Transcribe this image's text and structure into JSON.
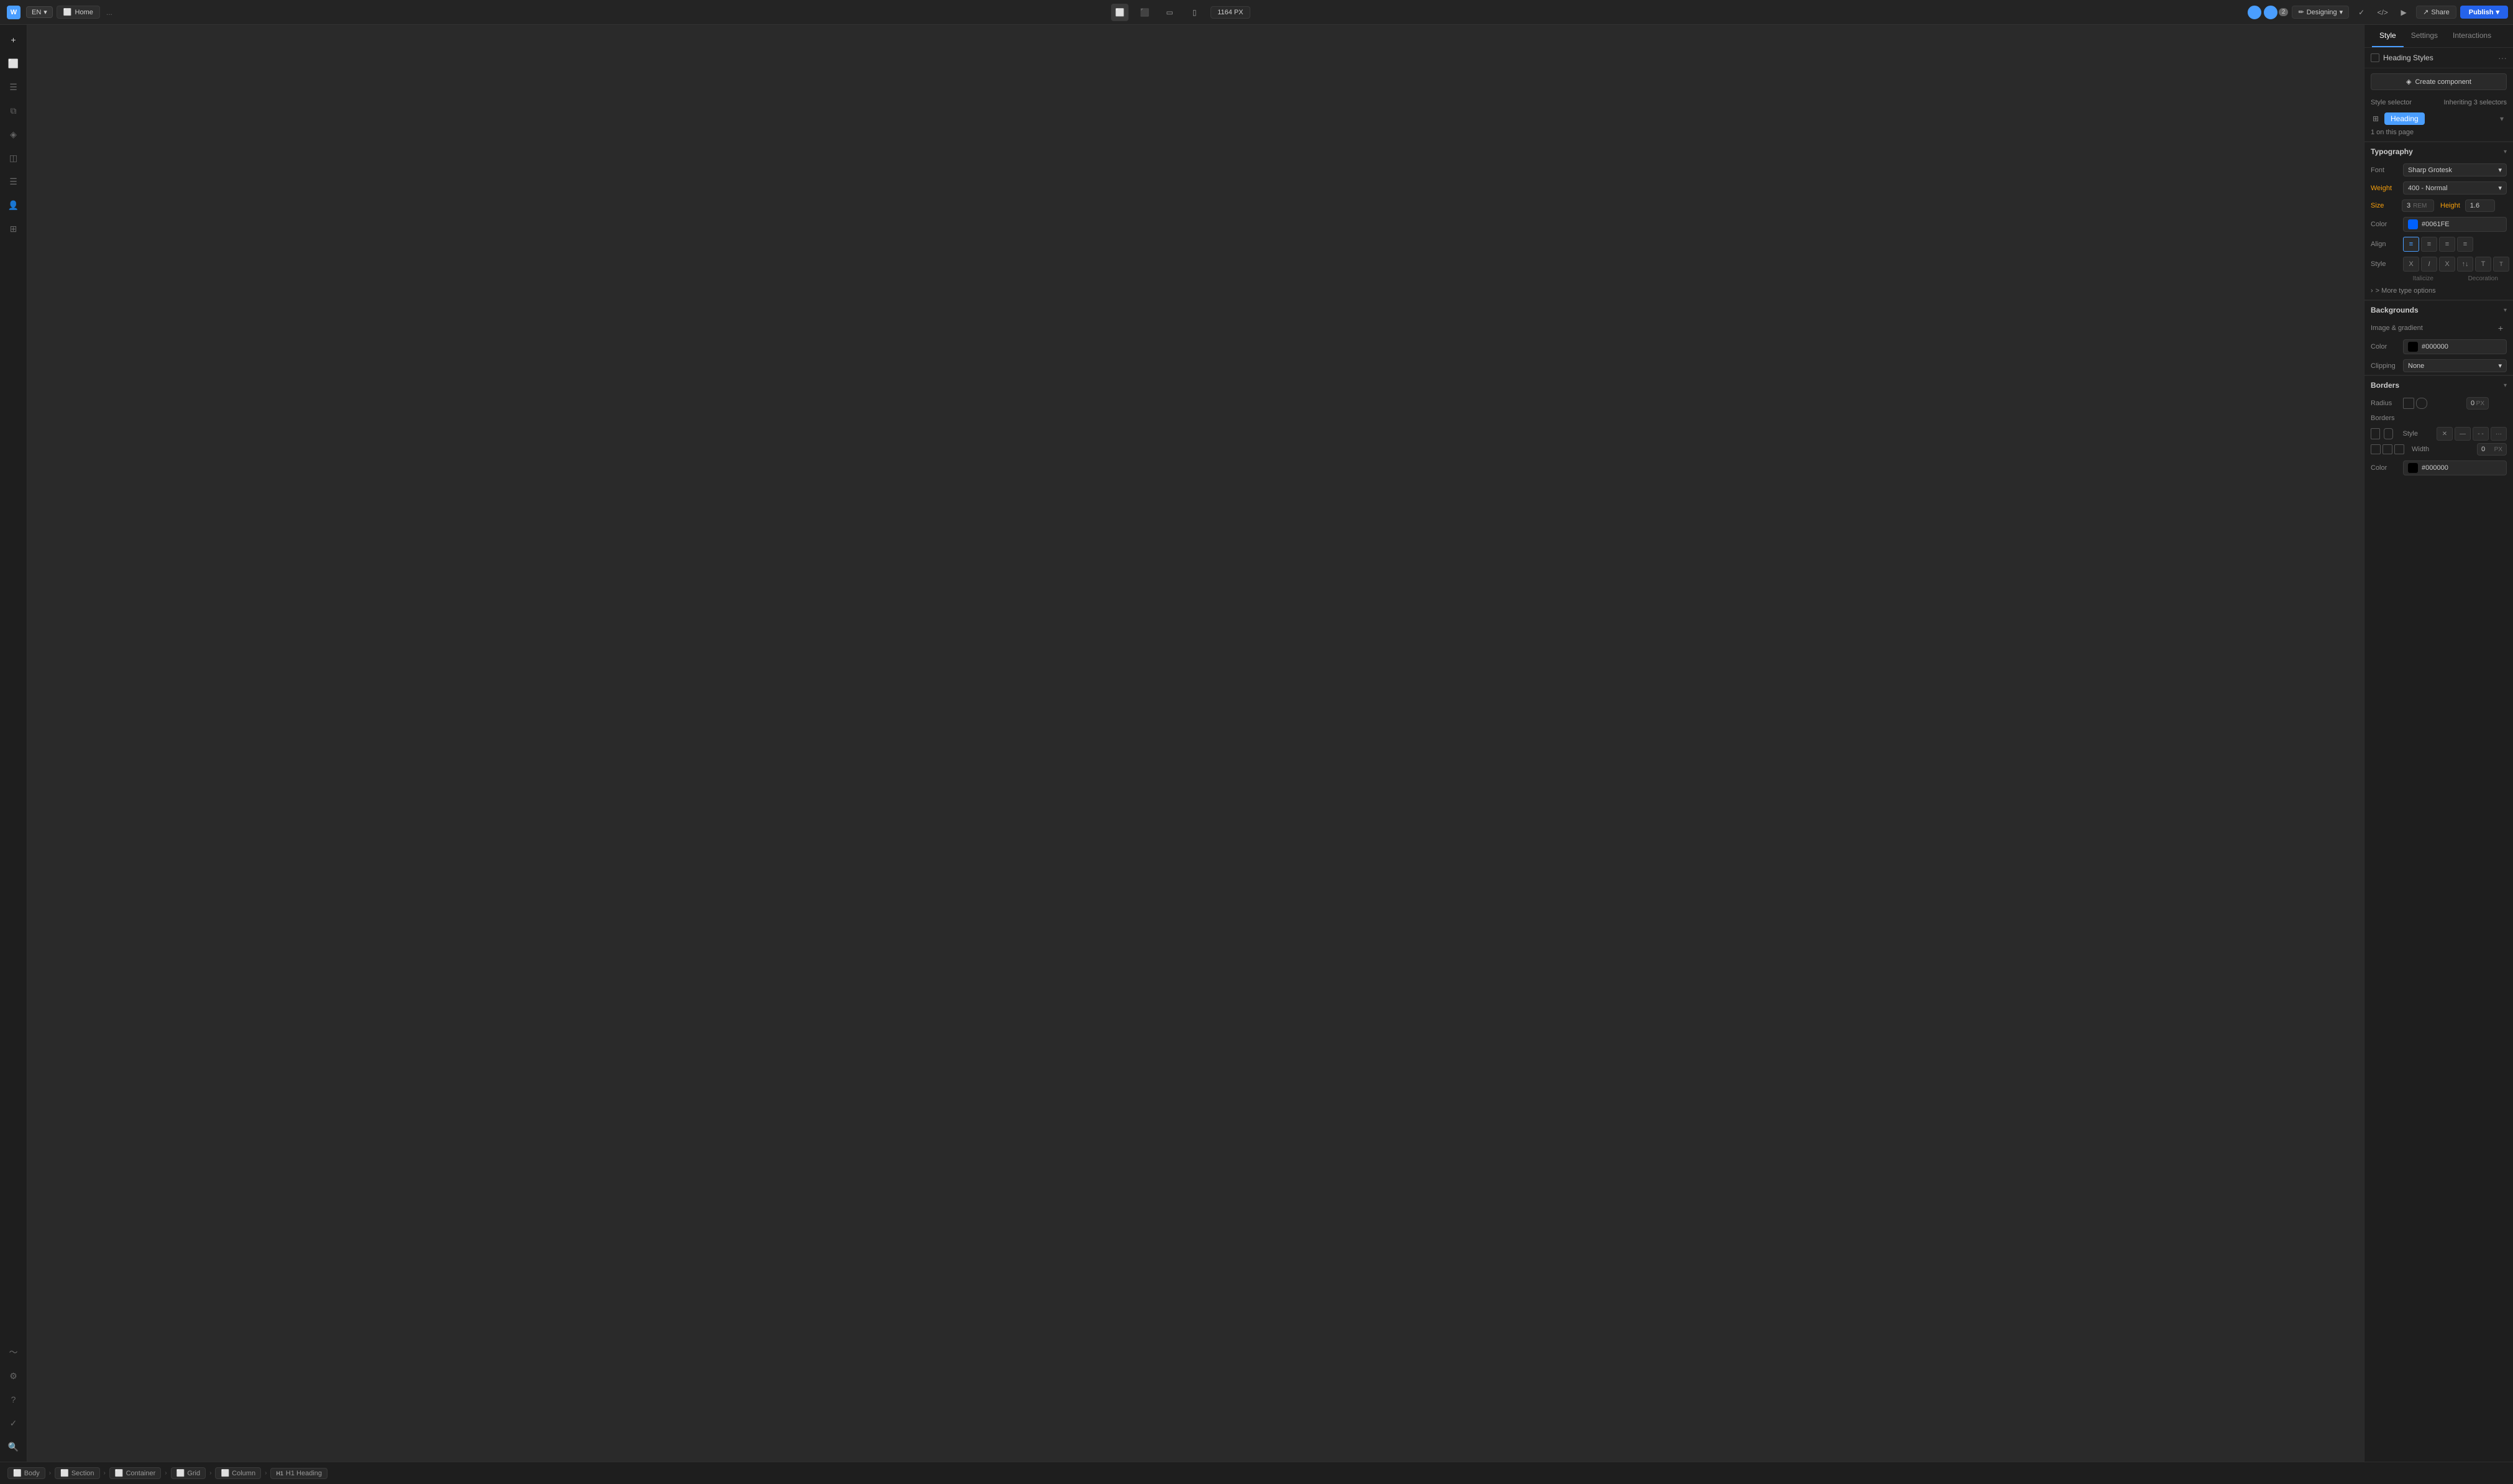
{
  "topbar": {
    "logo": "W",
    "lang": "EN",
    "page_tab": "Home",
    "dots": "...",
    "px_label": "1164 PX",
    "mode": "Designing",
    "share_label": "Share",
    "publish_label": "Publish",
    "users_count": "2"
  },
  "left_sidebar": {
    "icons": [
      {
        "name": "add-icon",
        "symbol": "+"
      },
      {
        "name": "pages-icon",
        "symbol": "⬜"
      },
      {
        "name": "menu-icon",
        "symbol": "☰"
      },
      {
        "name": "layers-icon",
        "symbol": "⧉"
      },
      {
        "name": "components-icon",
        "symbol": "◈"
      },
      {
        "name": "assets-icon",
        "symbol": "◫"
      },
      {
        "name": "cms-icon",
        "symbol": "⬡"
      },
      {
        "name": "members-icon",
        "symbol": "👤"
      },
      {
        "name": "apps-icon",
        "symbol": "⊞"
      },
      {
        "name": "activity-icon",
        "symbol": "〜"
      },
      {
        "name": "settings-icon",
        "symbol": "⚙"
      },
      {
        "name": "help-icon",
        "symbol": "?"
      },
      {
        "name": "check-icon",
        "symbol": "✓"
      },
      {
        "name": "search-icon",
        "symbol": "🔍"
      }
    ]
  },
  "right_panel": {
    "tabs": [
      "Style",
      "Settings",
      "Interactions"
    ],
    "active_tab": "Style",
    "heading_styles": {
      "label": "Heading Styles",
      "create_component": "Create component"
    },
    "style_selector": {
      "label": "Style selector",
      "inheriting_text": "Inheriting 3 selectors",
      "heading_chip": "Heading",
      "on_this_page": "1 on this page"
    },
    "typography": {
      "section_title": "Typography",
      "font_label": "Font",
      "font_value": "Sharp Grotesk",
      "weight_label": "Weight",
      "weight_value": "400 - Normal",
      "size_label": "Size",
      "size_value": "3",
      "size_unit": "REM",
      "height_label": "Height",
      "height_value": "1.6",
      "color_label": "Color",
      "color_value": "#0061FE",
      "color_hex": "#0061FE",
      "align_label": "Align",
      "align_options": [
        "left",
        "center",
        "right",
        "justify"
      ],
      "style_label": "Style",
      "style_options": [
        "X",
        "I",
        "X",
        "↑↓",
        "T",
        "T"
      ],
      "italicize_label": "Italicize",
      "decoration_label": "Decoration",
      "more_options": "> More type options"
    },
    "backgrounds": {
      "section_title": "Backgrounds",
      "image_gradient_label": "Image & gradient",
      "color_label": "Color",
      "color_value": "#000000",
      "color_hex": "#000000",
      "clipping_label": "Clipping",
      "clipping_value": "None"
    },
    "borders": {
      "section_title": "Borders",
      "radius_label": "Radius",
      "radius_value": "0",
      "radius_unit": "PX",
      "borders_label": "Borders",
      "style_label": "Style",
      "width_label": "Width",
      "width_value": "0",
      "width_unit": "PX",
      "color_label": "Color",
      "color_value": "#000000"
    }
  },
  "bottom_bar": {
    "breadcrumbs": [
      "Body",
      "Section",
      "Container",
      "Grid",
      "Column",
      "H1 Heading"
    ],
    "breadcrumb_icons": [
      "⬜",
      "⬜",
      "⬜",
      "⬜",
      "⬜",
      "H1"
    ]
  }
}
